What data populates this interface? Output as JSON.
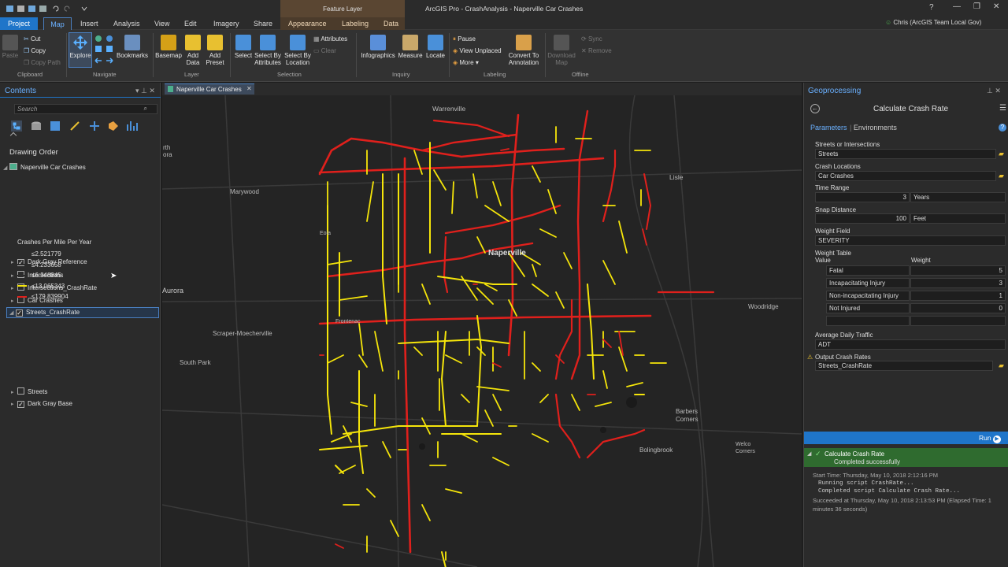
{
  "window": {
    "title": "ArcGIS Pro - CrashAnalysis - Naperville Car Crashes",
    "contextual_tab": "Feature Layer",
    "user": "Chris (ArcGIS Team Local Gov)",
    "help": "?",
    "minimize": "—",
    "maximize": "❐",
    "close": "✕"
  },
  "tabs": [
    "Project",
    "Map",
    "Insert",
    "Analysis",
    "View",
    "Edit",
    "Imagery",
    "Share",
    "Appearance",
    "Labeling",
    "Data"
  ],
  "ribbon": {
    "clipboard": {
      "paste": "Paste",
      "cut": "Cut",
      "copy": "Copy",
      "copy_path": "Copy Path",
      "group": "Clipboard"
    },
    "navigate": {
      "explore": "Explore",
      "bookmarks": "Bookmarks",
      "group": "Navigate"
    },
    "layer": {
      "basemap": "Basemap",
      "add_data": "Add Data",
      "add_preset": "Add Preset",
      "group": "Layer"
    },
    "selection": {
      "select": "Select",
      "by_attr": "Select By Attributes",
      "by_loc": "Select By Location",
      "attributes": "Attributes",
      "clear": "Clear",
      "group": "Selection"
    },
    "inquiry": {
      "infographics": "Infographics",
      "measure": "Measure",
      "locate": "Locate",
      "group": "Inquiry"
    },
    "labeling": {
      "pause": "Pause",
      "view_unplaced": "View Unplaced",
      "more": "More",
      "convert": "Convert To Annotation",
      "group": "Labeling"
    },
    "offline": {
      "download": "Download Map",
      "sync": "Sync",
      "remove": "Remove",
      "group": "Offline"
    }
  },
  "contents": {
    "title": "Contents",
    "search_placeholder": "Search",
    "drawing_order": "Drawing Order",
    "map_name": "Naperville Car Crashes",
    "layers": [
      {
        "name": "Dark Gray Reference",
        "checked": true
      },
      {
        "name": "Intersections",
        "checked": false
      },
      {
        "name": "Intersections_CrashRate",
        "checked": false
      },
      {
        "name": "Car Crashes",
        "checked": false
      },
      {
        "name": "Streets_CrashRate",
        "checked": true
      },
      {
        "name": "Streets",
        "checked": false
      },
      {
        "name": "Dark Gray Base",
        "checked": true
      }
    ],
    "legend_title": "Crashes Per Mile Per Year",
    "legend": [
      {
        "label": "≤2.521779",
        "color": "#2b2b2b"
      },
      {
        "label": "≤4.233658",
        "color": "#2b2b2b"
      },
      {
        "label": "≤6.348845",
        "color": "#2b2b2b"
      },
      {
        "label": "≤13.065343",
        "color": "#f5e50a"
      },
      {
        "label": "≤179.839904",
        "color": "#e0201c"
      }
    ]
  },
  "map": {
    "tab": "Naperville Car Crashes",
    "labels": [
      "Warrenville",
      "Lisle",
      "Marywood",
      "Naperville",
      "Aurora",
      "Woodridge",
      "Frontenac",
      "Scraper-Moecherville",
      "South Park",
      "Barbers Corners",
      "Bolingbrook",
      "Welco Corners",
      "rth",
      "ora",
      "Eola"
    ]
  },
  "gp": {
    "title": "Geoprocessing",
    "tool": "Calculate Crash Rate",
    "tab_params": "Parameters",
    "tab_env": "Environments",
    "p_streets": "Streets or Intersections",
    "v_streets": "Streets",
    "p_crash": "Crash Locations",
    "v_crash": "Car Crashes",
    "p_time": "Time Range",
    "v_time": "3",
    "v_time_unit": "Years",
    "p_snap": "Snap Distance",
    "v_snap": "100",
    "v_snap_unit": "Feet",
    "p_weight": "Weight Field",
    "v_weight": "SEVERITY",
    "p_table": "Weight Table",
    "col_value": "Value",
    "col_weight": "Weight",
    "rows": [
      {
        "v": "Fatal",
        "w": "5"
      },
      {
        "v": "Incapacitating Injury",
        "w": "3"
      },
      {
        "v": "Non-incapacitating Injury",
        "w": "1"
      },
      {
        "v": "Not Injured",
        "w": "0"
      }
    ],
    "p_adt": "Average Daily Traffic",
    "v_adt": "ADT",
    "p_out": "Output Crash Rates",
    "v_out": "Streets_CrashRate",
    "run": "Run",
    "status_title": "Calculate Crash Rate",
    "status": "Completed successfully",
    "log": [
      "Start Time: Thursday, May 10, 2018 2:12:16 PM",
      "Running script CrashRate...",
      "Completed script Calculate Crash Rate...",
      "Succeeded at Thursday, May 10, 2018 2:13:53 PM (Elapsed Time: 1",
      "minutes 36 seconds)"
    ]
  }
}
